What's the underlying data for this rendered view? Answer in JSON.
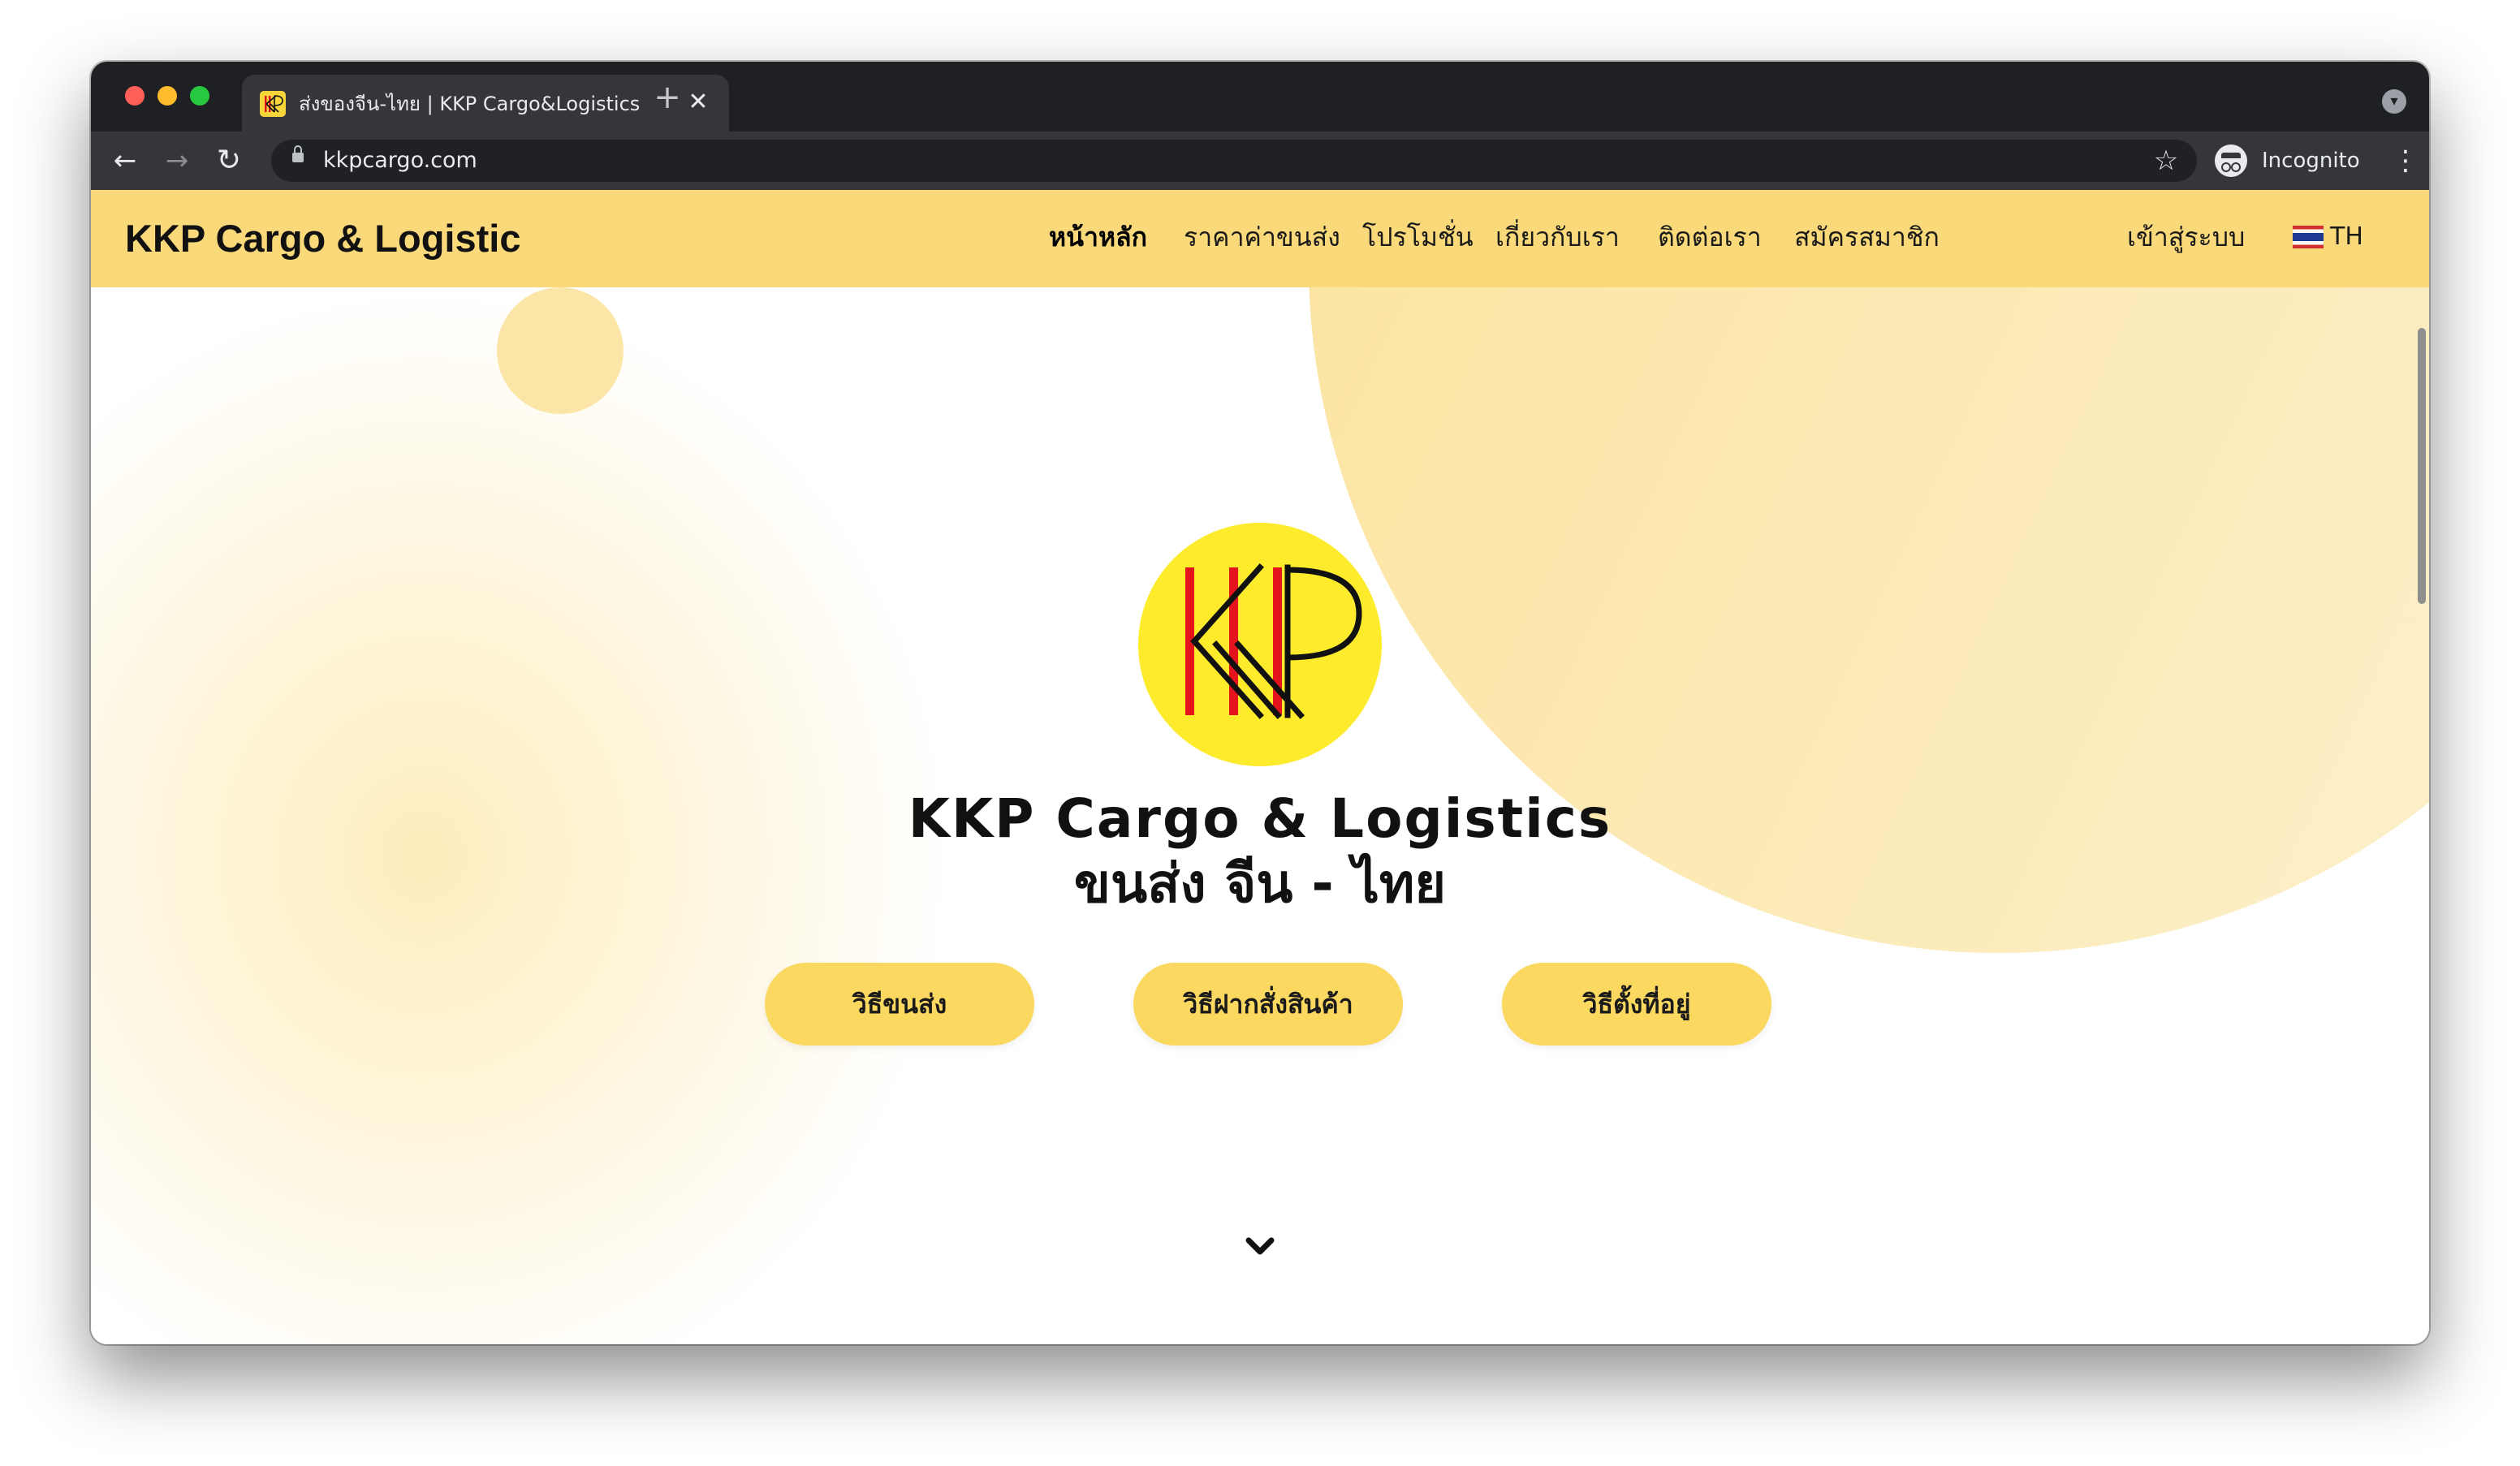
{
  "browser": {
    "tab_title": "ส่งของจีน-ไทย | KKP Cargo&Logistics",
    "tab_close": "✕",
    "new_tab": "+",
    "url": "kkpcargo.com",
    "profile_label": "Incognito"
  },
  "site": {
    "brand": "KKP Cargo & Logistic",
    "nav": [
      {
        "label": "หน้าหลัก",
        "active": true
      },
      {
        "label": "ราคาค่าขนส่ง"
      },
      {
        "label": "โปรโมชั่น"
      },
      {
        "label": "เกี่ยวกับเรา"
      },
      {
        "label": "ติดต่อเรา"
      },
      {
        "label": "สมัครสมาชิก"
      },
      {
        "label": "เข้าสู่ระบบ"
      }
    ],
    "language": "TH",
    "logo_text": "KKP"
  },
  "hero": {
    "title": "KKP Cargo & Logistics",
    "subtitle": "ขนส่ง จีน - ไทย",
    "buttons": [
      "วิธีขนส่ง",
      "วิธีฝากสั่งสินค้า",
      "วิธีตั้งที่อยู่"
    ]
  },
  "colors": {
    "nav_bg": "#f9d97a",
    "button_bg": "#fbd860",
    "logo_bg": "#fdeb2c",
    "logo_red": "#e3141c"
  },
  "icons": {
    "back": "arrow-left-icon",
    "forward": "arrow-right-icon",
    "reload": "reload-icon",
    "lock": "lock-icon",
    "star": "star-icon",
    "incognito": "incognito-icon",
    "menu": "kebab-menu-icon",
    "scroll": "chevron-down-icon"
  }
}
